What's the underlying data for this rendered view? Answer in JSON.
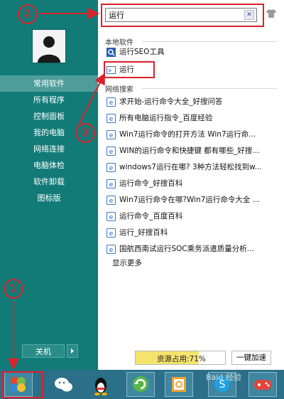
{
  "left_pane": {
    "nav": [
      "常用软件",
      "所有程序",
      "控制面板",
      "我的电脑",
      "网络连接",
      "电脑体检",
      "软件卸载",
      "图标版"
    ],
    "shutdown_label": "关机"
  },
  "search": {
    "value": "运行"
  },
  "local_section": {
    "title": "本地软件",
    "items": [
      "运行SEO工具",
      "运行"
    ]
  },
  "web_section": {
    "title": "网络搜索",
    "items": [
      "求开始-运行命令大全_好搜问答",
      "所有电脑运行指令_百度经验",
      "Win7运行命令的打开方法 Win7运行命...",
      "WIN的运行命令和快捷键 都有哪些_好搜...",
      "windows7运行在哪? 3种方法轻松找到w...",
      "运行命令_好搜百科",
      "Win7运行命令在哪?Win7运行命令大全 ...",
      "运行命令_百度百科",
      "运行_好搜百科",
      "国航西南试运行SOC乘务派遣质量分析..."
    ]
  },
  "more_label": "显示更多",
  "status": {
    "resource_text": "资源占用:71%",
    "resource_fraction": 0.71,
    "speedup_label": "一键加速"
  },
  "annotations": {
    "one": "①",
    "two": "②",
    "three": "③"
  },
  "watermark": "Baid 经验",
  "colors": {
    "accent_teal": "#127b78",
    "annotation_red": "#d8222a",
    "taskbar": "#2b6f88"
  },
  "taskbar_icons": [
    "start-orb-icon",
    "wechat-icon",
    "qq-penguin-icon",
    "refresh-green-icon",
    "outlook-icon",
    "skype-icon",
    "game-controller-icon"
  ]
}
